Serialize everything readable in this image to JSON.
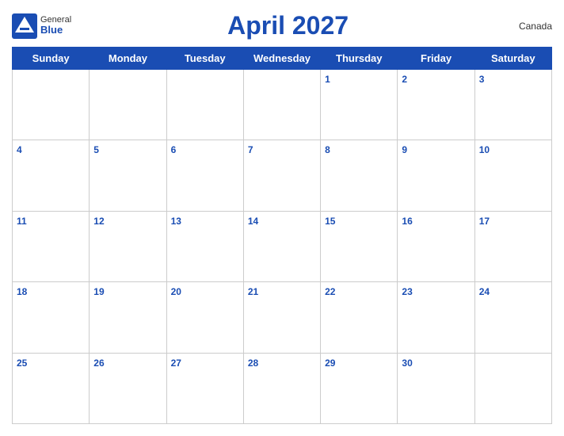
{
  "header": {
    "logo_general": "General",
    "logo_blue": "Blue",
    "title": "April 2027",
    "country": "Canada"
  },
  "days": [
    "Sunday",
    "Monday",
    "Tuesday",
    "Wednesday",
    "Thursday",
    "Friday",
    "Saturday"
  ],
  "weeks": [
    [
      {
        "date": "",
        "empty": true
      },
      {
        "date": "",
        "empty": true
      },
      {
        "date": "",
        "empty": true
      },
      {
        "date": "",
        "empty": true
      },
      {
        "date": "1"
      },
      {
        "date": "2"
      },
      {
        "date": "3"
      }
    ],
    [
      {
        "date": "4"
      },
      {
        "date": "5"
      },
      {
        "date": "6"
      },
      {
        "date": "7"
      },
      {
        "date": "8"
      },
      {
        "date": "9"
      },
      {
        "date": "10"
      }
    ],
    [
      {
        "date": "11"
      },
      {
        "date": "12"
      },
      {
        "date": "13"
      },
      {
        "date": "14"
      },
      {
        "date": "15"
      },
      {
        "date": "16"
      },
      {
        "date": "17"
      }
    ],
    [
      {
        "date": "18"
      },
      {
        "date": "19"
      },
      {
        "date": "20"
      },
      {
        "date": "21"
      },
      {
        "date": "22"
      },
      {
        "date": "23"
      },
      {
        "date": "24"
      }
    ],
    [
      {
        "date": "25"
      },
      {
        "date": "26"
      },
      {
        "date": "27"
      },
      {
        "date": "28"
      },
      {
        "date": "29"
      },
      {
        "date": "30"
      },
      {
        "date": "",
        "empty": true
      }
    ]
  ]
}
